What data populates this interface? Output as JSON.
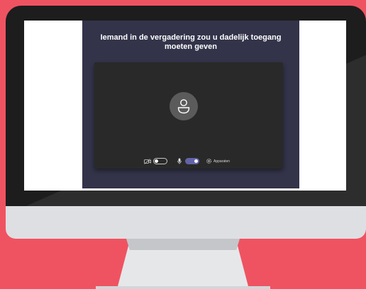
{
  "meeting_prejoin": {
    "prompt": "Iemand in de vergadering zou u dadelijk toegang moeten geven",
    "camera": {
      "icon": "camera-off-icon",
      "enabled": false
    },
    "microphone": {
      "icon": "mic-icon",
      "enabled": true
    },
    "devices": {
      "icon": "gear-icon",
      "label": "Apparaten"
    },
    "avatar": {
      "icon": "person-icon"
    }
  },
  "colors": {
    "background": "#ef5361",
    "app_background": "#33344a",
    "video_background": "#292929",
    "toggle_on": "#6264a7"
  }
}
